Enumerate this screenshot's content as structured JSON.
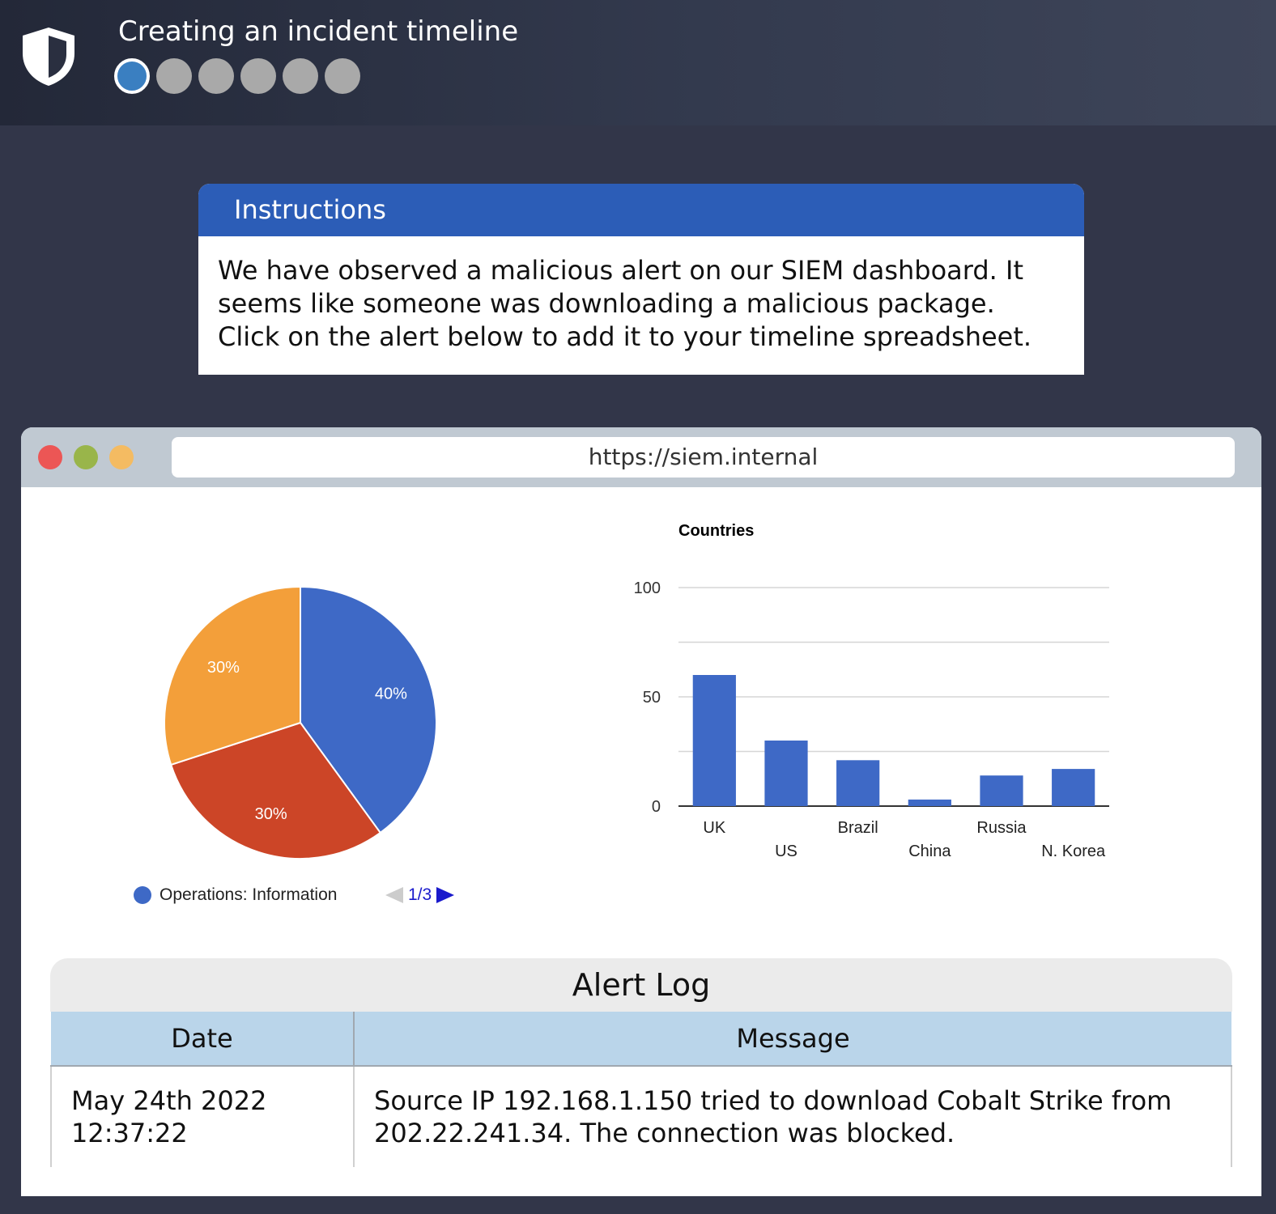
{
  "header": {
    "title": "Creating an incident timeline",
    "logo_icon": "shield-icon",
    "progress": {
      "current_step": 1,
      "total_steps": 6
    }
  },
  "instructions": {
    "heading": "Instructions",
    "body": "We have observed a malicious alert on our SIEM dashboard. It seems like someone was downloading a malicious package. Click on the alert below to add it to your timeline spreadsheet."
  },
  "browser": {
    "url": "https://siem.internal"
  },
  "colors": {
    "accent": "#2c5db7",
    "pie_blue": "#3e69c6",
    "pie_red": "#cc4527",
    "pie_orange": "#f39f3a",
    "bar": "#3e69c6"
  },
  "pie_legend": {
    "label": "Operations: Information",
    "pager": "1/3"
  },
  "chart_data": [
    {
      "type": "pie",
      "title": "",
      "slices": [
        {
          "label": "40%",
          "value": 40,
          "color": "#3e69c6"
        },
        {
          "label": "30%",
          "value": 30,
          "color": "#cc4527"
        },
        {
          "label": "30%",
          "value": 30,
          "color": "#f39f3a"
        }
      ],
      "legend": [
        "Operations: Information"
      ],
      "legend_placement": "bottom"
    },
    {
      "type": "bar",
      "title": "Countries",
      "categories": [
        "UK",
        "US",
        "Brazil",
        "China",
        "Russia",
        "N. Korea"
      ],
      "values": [
        60,
        30,
        21,
        3,
        14,
        17
      ],
      "ylim": [
        0,
        100
      ],
      "yticks": [
        "0",
        "50",
        "100"
      ],
      "grid": true,
      "xlabel": "",
      "ylabel": ""
    }
  ],
  "alert_log": {
    "title": "Alert Log",
    "columns": [
      "Date",
      "Message"
    ],
    "rows": [
      {
        "date_line1": "May 24th 2022",
        "date_line2": "12:37:22",
        "message_line1": "Source IP 192.168.1.150 tried to download Cobalt Strike from",
        "message_line2": "202.22.241.34. The connection was blocked."
      }
    ]
  }
}
